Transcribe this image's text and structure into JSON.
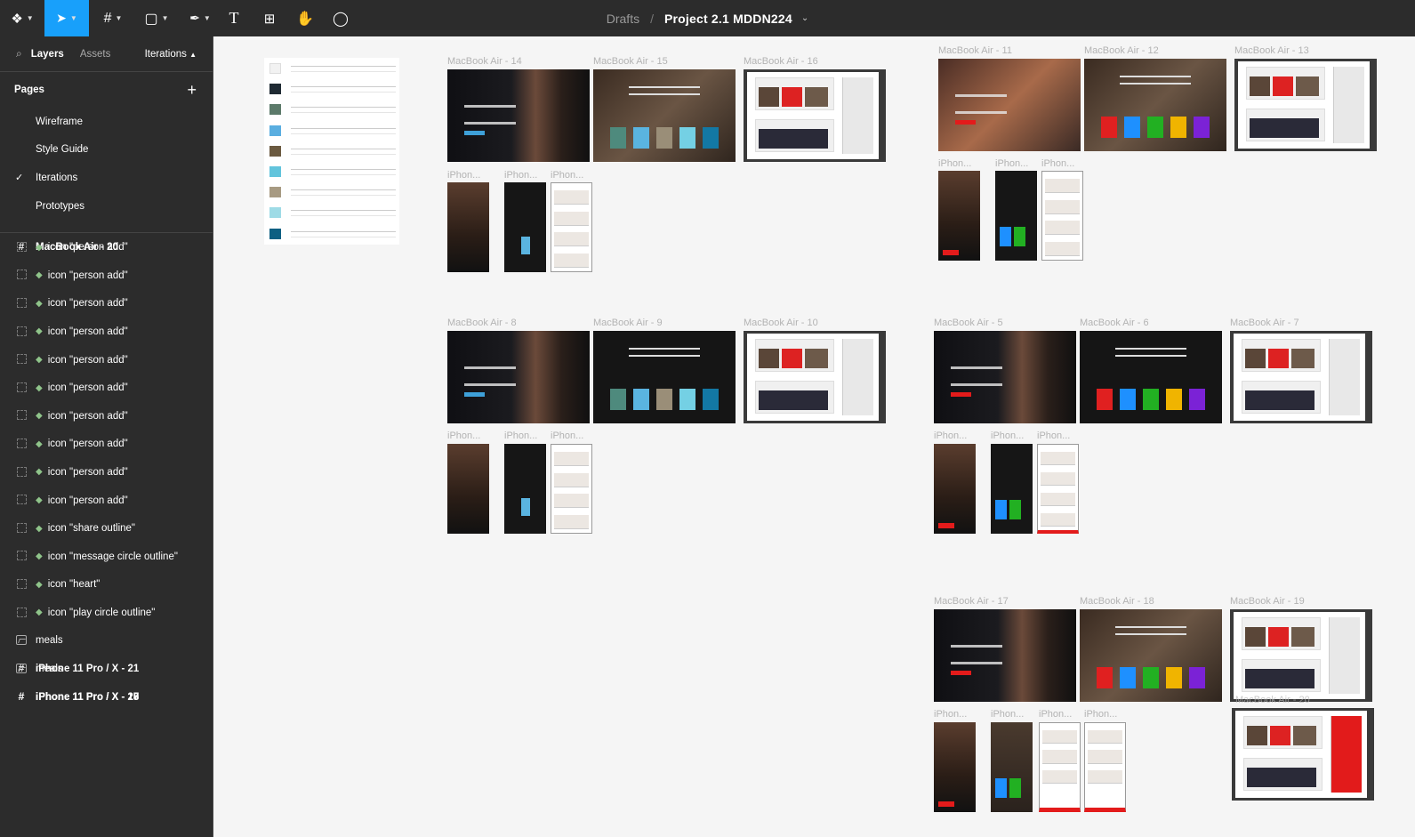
{
  "toolbar": {
    "tools": [
      {
        "name": "main-menu",
        "glyph": "◈",
        "active": false
      },
      {
        "name": "move-tool",
        "glyph": "➤",
        "active": true
      },
      {
        "name": "frame-tool",
        "glyph": "#",
        "active": false
      },
      {
        "name": "shape-tool",
        "glyph": "▢",
        "active": false
      },
      {
        "name": "pen-tool",
        "glyph": "✒",
        "active": false
      },
      {
        "name": "text-tool",
        "glyph": "T",
        "active": false
      },
      {
        "name": "resources-tool",
        "glyph": "⊞",
        "active": false
      },
      {
        "name": "hand-tool",
        "glyph": "✋",
        "active": false
      },
      {
        "name": "comment-tool",
        "glyph": "◯",
        "active": false
      }
    ],
    "breadcrumb": "Drafts",
    "separator": "/",
    "project": "Project 2.1 MDDN224"
  },
  "sidebar": {
    "tabs": {
      "layers": "Layers",
      "assets": "Assets",
      "page": "Iterations"
    },
    "pages_heading": "Pages",
    "pages": [
      {
        "label": "Wireframe",
        "checked": false
      },
      {
        "label": "Style Guide",
        "checked": false
      },
      {
        "label": "Iterations",
        "checked": true
      },
      {
        "label": "Prototypes",
        "checked": false
      }
    ],
    "layers": [
      {
        "label": "MacBook Air - 20",
        "kind": "frame"
      },
      {
        "label": "icon \"person add\"",
        "kind": "component"
      },
      {
        "label": "icon \"person add\"",
        "kind": "component"
      },
      {
        "label": "icon \"person add\"",
        "kind": "component"
      },
      {
        "label": "icon \"person add\"",
        "kind": "component"
      },
      {
        "label": "icon \"person add\"",
        "kind": "component"
      },
      {
        "label": "icon \"person add\"",
        "kind": "component"
      },
      {
        "label": "icon \"person add\"",
        "kind": "component"
      },
      {
        "label": "icon \"person add\"",
        "kind": "component"
      },
      {
        "label": "icon \"person add\"",
        "kind": "component"
      },
      {
        "label": "icon \"person add\"",
        "kind": "component"
      },
      {
        "label": "icon \"share outline\"",
        "kind": "component"
      },
      {
        "label": "icon \"message circle outline\"",
        "kind": "component"
      },
      {
        "label": "icon \"heart\"",
        "kind": "component"
      },
      {
        "label": "icon \"play circle outline\"",
        "kind": "component"
      },
      {
        "label": "meals",
        "kind": "image"
      },
      {
        "label": "iPhone 11 Pro / X - 21",
        "kind": "frame"
      },
      {
        "label": "meals",
        "kind": "image"
      },
      {
        "label": "iPhone 11 Pro / X - 20",
        "kind": "frame"
      },
      {
        "label": "iPhone 11 Pro / X - 18",
        "kind": "frame"
      },
      {
        "label": "iPhone 11 Pro / X - 17",
        "kind": "frame"
      }
    ]
  },
  "canvas": {
    "frame_labels": {
      "mb14": "MacBook Air - 14",
      "mb15": "MacBook Air - 15",
      "mb16": "MacBook Air - 16",
      "mb11": "MacBook Air - 11",
      "mb12": "MacBook Air - 12",
      "mb13": "MacBook Air - 13",
      "mb8": "MacBook Air - 8",
      "mb9": "MacBook Air - 9",
      "mb10": "MacBook Air - 10",
      "mb5": "MacBook Air - 5",
      "mb6": "MacBook Air - 6",
      "mb7": "MacBook Air - 7",
      "mb17": "MacBook Air - 17",
      "mb18": "MacBook Air - 18",
      "mb19": "MacBook Air - 19",
      "mb20": "MacBook Air - 20",
      "iphone": "iPhon..."
    },
    "swatch_colors": [
      "#f2f2f2",
      "#1f2a33",
      "#5c7a6a",
      "#5aaee0",
      "#6b5a40",
      "#62c4dc",
      "#a79a82",
      "#9edbe6",
      "#0d5f82"
    ],
    "tile_colors_blue": [
      "#4e8a7d",
      "#5ab4e0",
      "#9a8e78",
      "#74d0e4",
      "#1378a4"
    ],
    "tile_colors_vivid": [
      "#e02020",
      "#1e90ff",
      "#22b022",
      "#f0b400",
      "#7b22d6"
    ]
  }
}
